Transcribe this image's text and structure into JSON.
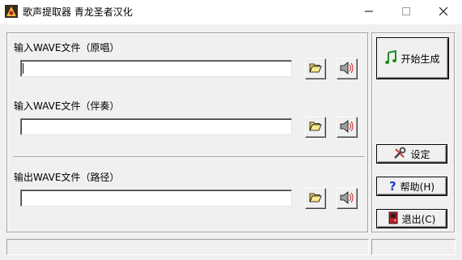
{
  "window": {
    "title": "歌声提取器 青龙圣者汉化",
    "minimize_glyph": "—",
    "maximize_glyph": "☐",
    "close_glyph": "✕"
  },
  "inputs": [
    {
      "label": "输入WAVE文件（原唱）",
      "value": ""
    },
    {
      "label": "输入WAVE文件（伴奏）",
      "value": ""
    },
    {
      "label": "输出WAVE文件（路径）",
      "value": ""
    }
  ],
  "buttons": {
    "generate": "开始生成",
    "settings": "设定",
    "help": "帮助(H)",
    "exit": "退出(C)"
  },
  "status_bar": {
    "left": "",
    "right": ""
  },
  "icons": {
    "app": "app-logo-icon",
    "browse": "folder-open-icon",
    "play": "speaker-icon",
    "generate": "music-note-icon",
    "settings": "tools-icon",
    "help": "question-icon",
    "exit": "exit-door-icon"
  },
  "colors": {
    "window_bg": "#f0f0f0",
    "titlebar_bg": "#ffffff",
    "note_green": "#1f8a1f",
    "help_blue": "#1a3fd0",
    "exit_red": "#c0202a"
  }
}
